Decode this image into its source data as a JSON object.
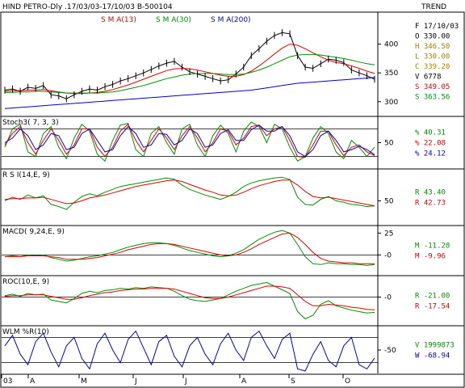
{
  "header": {
    "title": "HIND PETRO-Dly .17/03/03-17/10/03  B-500104",
    "trend_label": "TREND"
  },
  "colors": {
    "sma13": "#e00000",
    "sma30": "#009000",
    "sma200": "#0000cc",
    "price": "#000000",
    "grid": "#000000"
  },
  "chart_data": [
    {
      "panel": "price",
      "type": "line",
      "legend": [
        {
          "name": "S M A(13)",
          "color": "#e00000"
        },
        {
          "name": "S M A(30)",
          "color": "#009000"
        },
        {
          "name": "S M A(200)",
          "color": "#0000cc"
        }
      ],
      "ylim": [
        280,
        450
      ],
      "yticks": [
        300,
        350,
        400
      ],
      "ohlc_readout": {
        "date": "F 17/10/03",
        "open": "O  330.00",
        "high": "H  346.50",
        "low": "L  330.00",
        "close": "C  339.20",
        "volume": "V    6778",
        "sma13": "S  349.05",
        "sma30": "S  363.56"
      },
      "series": [
        {
          "name": "Close",
          "values": [
            320,
            322,
            318,
            325,
            323,
            328,
            312,
            310,
            305,
            312,
            318,
            322,
            320,
            326,
            330,
            336,
            340,
            345,
            350,
            356,
            362,
            367,
            370,
            360,
            352,
            348,
            344,
            340,
            336,
            338,
            348,
            360,
            380,
            392,
            405,
            415,
            420,
            418,
            380,
            360,
            358,
            366,
            374,
            372,
            368,
            355,
            350,
            345,
            339
          ]
        },
        {
          "name": "SMA13",
          "values": [
            318,
            319,
            319,
            320,
            320,
            321,
            319,
            317,
            315,
            314,
            314,
            315,
            316,
            318,
            321,
            325,
            329,
            334,
            339,
            344,
            349,
            354,
            357,
            358,
            357,
            355,
            352,
            349,
            346,
            344,
            344,
            347,
            353,
            362,
            372,
            383,
            393,
            400,
            398,
            392,
            385,
            378,
            372,
            368,
            366,
            362,
            358,
            353,
            349
          ]
        },
        {
          "name": "SMA30",
          "values": [
            316,
            316,
            317,
            317,
            318,
            318,
            317,
            316,
            315,
            315,
            315,
            315,
            315,
            316,
            317,
            319,
            322,
            325,
            328,
            332,
            336,
            340,
            343,
            346,
            348,
            349,
            349,
            349,
            348,
            347,
            347,
            348,
            351,
            355,
            360,
            366,
            372,
            378,
            381,
            382,
            382,
            381,
            379,
            377,
            375,
            372,
            369,
            366,
            364
          ]
        },
        {
          "name": "SMA200",
          "values": [
            288,
            289,
            290,
            291,
            292,
            293,
            294,
            295,
            296,
            297,
            298,
            299,
            300,
            301,
            302,
            303,
            304,
            305,
            306,
            307,
            308,
            309,
            310,
            311,
            312,
            313,
            314,
            315,
            316,
            317,
            318,
            319,
            320,
            322,
            324,
            326,
            328,
            330,
            332,
            333,
            334,
            335,
            336,
            337,
            338,
            339,
            340,
            341,
            342
          ]
        }
      ]
    },
    {
      "panel": "stoch",
      "type": "line",
      "title": "Stoch3( 7, 3, 3)",
      "ylim": [
        0,
        100
      ],
      "yticks": [
        50
      ],
      "hlines": [
        20,
        80
      ],
      "readout": [
        {
          "text": "%      40.31",
          "color": "#009000"
        },
        {
          "text": "%      22.08",
          "color": "#e00000"
        },
        {
          "text": "%      24.12",
          "color": "#0000cc"
        }
      ],
      "series": [
        {
          "name": "%K",
          "color": "#009000",
          "values": [
            40,
            80,
            90,
            30,
            20,
            70,
            85,
            40,
            15,
            60,
            90,
            75,
            25,
            10,
            55,
            88,
            92,
            35,
            20,
            70,
            85,
            50,
            25,
            80,
            90,
            45,
            20,
            65,
            88,
            70,
            30,
            75,
            95,
            85,
            50,
            90,
            80,
            40,
            10,
            20,
            60,
            85,
            70,
            30,
            15,
            55,
            40,
            20,
            40
          ]
        },
        {
          "name": "%D",
          "color": "#e00000",
          "values": [
            45,
            70,
            85,
            50,
            25,
            55,
            80,
            55,
            25,
            45,
            80,
            80,
            40,
            20,
            40,
            75,
            90,
            55,
            30,
            55,
            80,
            60,
            35,
            65,
            85,
            60,
            30,
            50,
            80,
            75,
            45,
            60,
            85,
            88,
            65,
            80,
            85,
            55,
            20,
            18,
            45,
            75,
            75,
            45,
            22,
            40,
            45,
            30,
            22
          ]
        },
        {
          "name": "%Slow",
          "color": "#0000cc",
          "values": [
            50,
            60,
            80,
            65,
            35,
            45,
            70,
            65,
            35,
            40,
            70,
            80,
            55,
            30,
            35,
            65,
            85,
            70,
            40,
            45,
            70,
            68,
            45,
            55,
            80,
            70,
            40,
            45,
            70,
            78,
            55,
            55,
            78,
            88,
            75,
            75,
            85,
            65,
            30,
            20,
            35,
            65,
            75,
            55,
            30,
            35,
            42,
            35,
            24
          ]
        }
      ]
    },
    {
      "panel": "rsi",
      "type": "line",
      "title": "R S I(14,E, 9)",
      "ylim": [
        20,
        90
      ],
      "yticks": [
        50
      ],
      "readout": [
        {
          "text": "R       43.40",
          "color": "#009000"
        },
        {
          "text": "R       42.73",
          "color": "#e00000"
        }
      ],
      "series": [
        {
          "name": "RSI",
          "color": "#009000",
          "values": [
            50,
            55,
            52,
            58,
            54,
            57,
            45,
            42,
            38,
            48,
            56,
            60,
            57,
            62,
            66,
            70,
            72,
            74,
            76,
            78,
            80,
            82,
            80,
            72,
            66,
            62,
            58,
            55,
            52,
            56,
            62,
            70,
            75,
            78,
            80,
            82,
            83,
            80,
            55,
            45,
            44,
            52,
            56,
            50,
            48,
            45,
            44,
            42,
            43
          ]
        },
        {
          "name": "Signal",
          "color": "#e00000",
          "values": [
            52,
            53,
            53,
            54,
            54,
            55,
            52,
            49,
            46,
            47,
            50,
            54,
            56,
            58,
            61,
            64,
            67,
            70,
            72,
            74,
            76,
            78,
            79,
            77,
            73,
            69,
            65,
            62,
            58,
            57,
            58,
            62,
            67,
            71,
            74,
            77,
            79,
            79,
            72,
            63,
            56,
            54,
            55,
            53,
            51,
            49,
            47,
            45,
            43
          ]
        }
      ]
    },
    {
      "panel": "macd",
      "type": "line",
      "title": "MACD( 9,24,E, 9)",
      "ylim": [
        -20,
        30
      ],
      "yticks": [
        25,
        0
      ],
      "ytick_labels": [
        "25",
        "-0"
      ],
      "readout": [
        {
          "text": "M      -11.28",
          "color": "#009000"
        },
        {
          "text": "M       -9.96",
          "color": "#e00000"
        }
      ],
      "series": [
        {
          "name": "MACD",
          "color": "#009000",
          "values": [
            -2,
            -1,
            -2,
            0,
            -1,
            0,
            -3,
            -5,
            -7,
            -6,
            -4,
            -2,
            -1,
            1,
            3,
            6,
            9,
            11,
            13,
            14,
            14,
            13,
            11,
            8,
            5,
            3,
            1,
            -1,
            -2,
            -1,
            2,
            6,
            12,
            18,
            22,
            26,
            28,
            25,
            12,
            -2,
            -10,
            -11,
            -9,
            -10,
            -10,
            -11,
            -11,
            -12,
            -11
          ]
        },
        {
          "name": "Signal",
          "color": "#e00000",
          "values": [
            -2,
            -2,
            -2,
            -1,
            -1,
            -1,
            -2,
            -3,
            -5,
            -5,
            -5,
            -4,
            -3,
            -1,
            1,
            3,
            6,
            8,
            10,
            12,
            13,
            13,
            12,
            10,
            8,
            6,
            4,
            2,
            0,
            -1,
            0,
            3,
            7,
            12,
            16,
            20,
            24,
            25,
            20,
            12,
            3,
            -4,
            -7,
            -8,
            -9,
            -9,
            -10,
            -10,
            -10
          ]
        }
      ]
    },
    {
      "panel": "roc",
      "type": "line",
      "title": "ROC(10,E, 9)",
      "ylim": [
        -35,
        25
      ],
      "yticks": [
        0
      ],
      "ytick_labels": [
        "-0"
      ],
      "readout": [
        {
          "text": "R      -21.00",
          "color": "#009000"
        },
        {
          "text": "R      -17.54",
          "color": "#e00000"
        }
      ],
      "series": [
        {
          "name": "ROC",
          "color": "#009000",
          "values": [
            2,
            4,
            1,
            5,
            3,
            4,
            -4,
            -6,
            -8,
            -2,
            5,
            8,
            6,
            9,
            10,
            12,
            11,
            13,
            12,
            14,
            13,
            12,
            8,
            2,
            -3,
            -5,
            -6,
            -4,
            -2,
            3,
            8,
            12,
            16,
            18,
            20,
            15,
            10,
            5,
            -20,
            -30,
            -25,
            -10,
            -5,
            -12,
            -15,
            -18,
            -20,
            -22,
            -21
          ]
        },
        {
          "name": "Signal",
          "color": "#e00000",
          "values": [
            1,
            2,
            2,
            3,
            3,
            3,
            1,
            -1,
            -3,
            -3,
            -1,
            2,
            4,
            6,
            7,
            9,
            10,
            11,
            11,
            12,
            12,
            12,
            11,
            8,
            5,
            2,
            -1,
            -2,
            -2,
            0,
            3,
            6,
            9,
            12,
            15,
            15,
            14,
            12,
            3,
            -6,
            -12,
            -12,
            -10,
            -11,
            -12,
            -14,
            -15,
            -17,
            -17.54
          ]
        }
      ]
    },
    {
      "panel": "wlm",
      "type": "line",
      "title": "WLM %R(10)",
      "ylim": [
        -100,
        0
      ],
      "yticks": [
        -50
      ],
      "hlines": [
        -20,
        -80
      ],
      "readout": [
        {
          "text": "V  1999873",
          "color": "#009000"
        },
        {
          "text": "W      -68.94",
          "color": "#0000cc"
        }
      ],
      "series": [
        {
          "name": "%R",
          "color": "#0000cc",
          "values": [
            -40,
            -15,
            -60,
            -85,
            -30,
            -10,
            -55,
            -90,
            -40,
            -20,
            -70,
            -95,
            -35,
            -10,
            -50,
            -80,
            -25,
            -5,
            -45,
            -85,
            -30,
            -15,
            -65,
            -90,
            -40,
            -20,
            -60,
            -85,
            -35,
            -10,
            -50,
            -75,
            -20,
            -5,
            -40,
            -70,
            -25,
            -10,
            -95,
            -100,
            -60,
            -30,
            -75,
            -90,
            -40,
            -20,
            -85,
            -95,
            -69
          ]
        }
      ]
    }
  ],
  "xaxis": {
    "labels": [
      "03",
      "A",
      "M",
      "J",
      "J",
      "A",
      "S",
      "O"
    ]
  }
}
